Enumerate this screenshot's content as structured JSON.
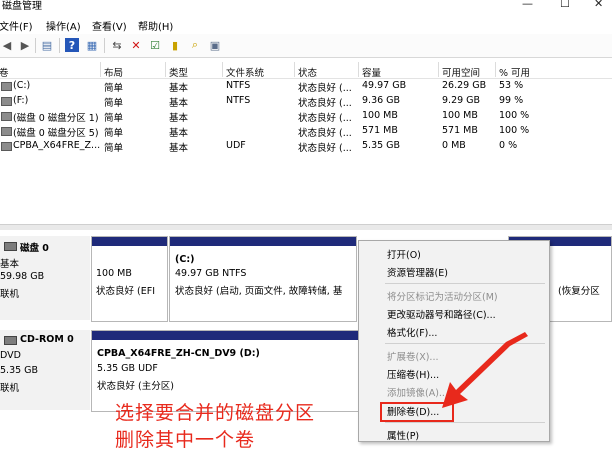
{
  "window": {
    "title": "磁盘管理"
  },
  "menu": [
    "文件(F)",
    "操作(A)",
    "查看(V)",
    "帮助(H)"
  ],
  "volume_table": {
    "columns": [
      "卷",
      "布局",
      "类型",
      "文件系统",
      "状态",
      "容量",
      "可用空间",
      "% 可用"
    ],
    "rows": [
      [
        "(C:)",
        "简单",
        "基本",
        "NTFS",
        "状态良好 (...",
        "49.97 GB",
        "26.29 GB",
        "53 %"
      ],
      [
        "(F:)",
        "简单",
        "基本",
        "NTFS",
        "状态良好 (...",
        "9.36 GB",
        "9.29 GB",
        "99 %"
      ],
      [
        "(磁盘 0 磁盘分区 1)",
        "简单",
        "基本",
        "",
        "状态良好 (...",
        "100 MB",
        "100 MB",
        "100 %"
      ],
      [
        "(磁盘 0 磁盘分区 5)",
        "简单",
        "基本",
        "",
        "状态良好 (...",
        "571 MB",
        "571 MB",
        "100 %"
      ],
      [
        "CPBA_X64FRE_Z...",
        "简单",
        "基本",
        "UDF",
        "状态良好 (...",
        "5.35 GB",
        "0 MB",
        "0 %"
      ]
    ]
  },
  "disks": [
    {
      "name": "磁盘 0",
      "type": "基本",
      "size": "59.98 GB",
      "status": "联机",
      "partitions": [
        {
          "title": "",
          "size": "100 MB",
          "status": "状态良好 (EFI"
        },
        {
          "title": "(C:)",
          "size": "49.97 GB NTFS",
          "status": "状态良好 (启动, 页面文件, 故障转储, 基"
        },
        {
          "title": "",
          "size": "",
          "status": "(恢复分区"
        }
      ]
    },
    {
      "name": "CD-ROM 0",
      "type": "DVD",
      "size": "5.35 GB",
      "status": "联机",
      "partitions": [
        {
          "title": "CPBA_X64FRE_ZH-CN_DV9  (D:)",
          "size": "5.35 GB UDF",
          "status": "状态良好 (主分区)"
        }
      ]
    }
  ],
  "context_menu": [
    {
      "label": "打开(O)",
      "enabled": true
    },
    {
      "label": "资源管理器(E)",
      "enabled": true
    },
    {
      "label": "将分区标记为活动分区(M)",
      "enabled": false
    },
    {
      "label": "更改驱动器号和路径(C)...",
      "enabled": true
    },
    {
      "label": "格式化(F)...",
      "enabled": true
    },
    {
      "label": "扩展卷(X)...",
      "enabled": false
    },
    {
      "label": "压缩卷(H)...",
      "enabled": true
    },
    {
      "label": "添加镜像(A)...",
      "enabled": false
    },
    {
      "label": "删除卷(D)...",
      "enabled": true
    },
    {
      "label": "属性(P)",
      "enabled": true
    }
  ],
  "annotation": {
    "line1": "选择要合并的磁盘分区",
    "line2": "删除其中一个卷"
  },
  "colors": {
    "partition_bar": "#1f2a7a",
    "annotation": "#e8291c"
  },
  "icons": [
    "back-icon",
    "forward-icon",
    "console-icon",
    "help-icon",
    "view-icon",
    "connect-icon",
    "delete-icon",
    "check-icon",
    "add-icon",
    "search-icon",
    "properties-icon",
    "disk-icon",
    "cdrom-icon"
  ]
}
